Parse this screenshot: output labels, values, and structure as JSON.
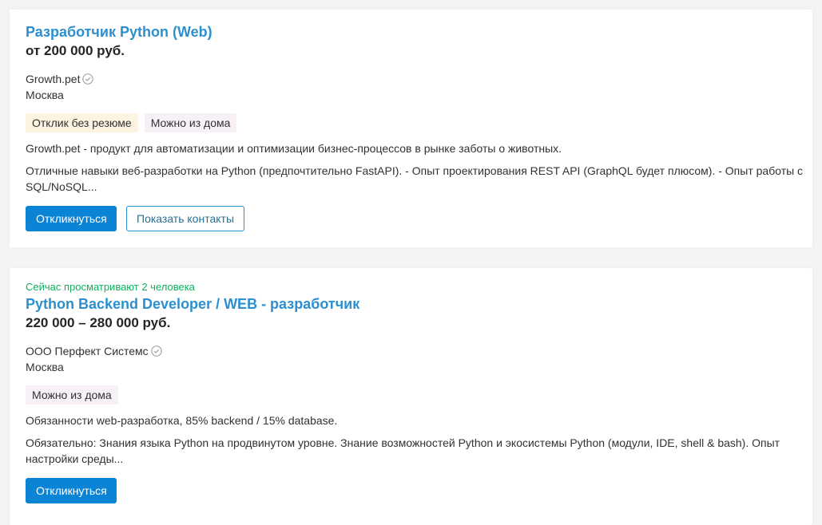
{
  "vacancies": [
    {
      "title": "Разработчик Python (Web)",
      "salary": "от 200 000 руб.",
      "company": "Growth.pet",
      "city": "Москва",
      "tags": [
        "Отклик без резюме",
        "Можно из дома"
      ],
      "description": "Growth.pet - продукт для автоматизации и оптимизации бизнес-процессов в рынке заботы о животных.",
      "requirements": "Отличные навыки веб-разработки на Python (предпочтительно FastAPI). - Опыт проектирования REST API (GraphQL будет плюсом). - Опыт работы с SQL/NoSQL...",
      "respond_label": "Откликнуться",
      "contacts_label": "Показать контакты",
      "verified_icon": "check-circle-icon"
    },
    {
      "viewers": "Сейчас просматривают 2 человека",
      "title": "Python Backend Developer / WEB - разработчик",
      "salary": "220 000 – 280 000 руб.",
      "company": "ООО Перфект Системс",
      "city": "Москва",
      "tags": [
        "Можно из дома"
      ],
      "description": "Обязанности web-разработка, 85% backend / 15% database.",
      "requirements": "Обязательно: Знания языка Python на продвинутом уровне. Знание возможностей Python и экосистемы Python (модули, IDE, shell & bash). Опыт настройки среды...",
      "respond_label": "Откликнуться",
      "verified_icon": "check-circle-icon"
    }
  ],
  "colors": {
    "link": "#2b8fd0",
    "primary_button": "#0b84d6",
    "viewers_text": "#0cb35b",
    "tag_yellow": "#fcf3e0",
    "tag_pink": "#f7f0f7"
  }
}
